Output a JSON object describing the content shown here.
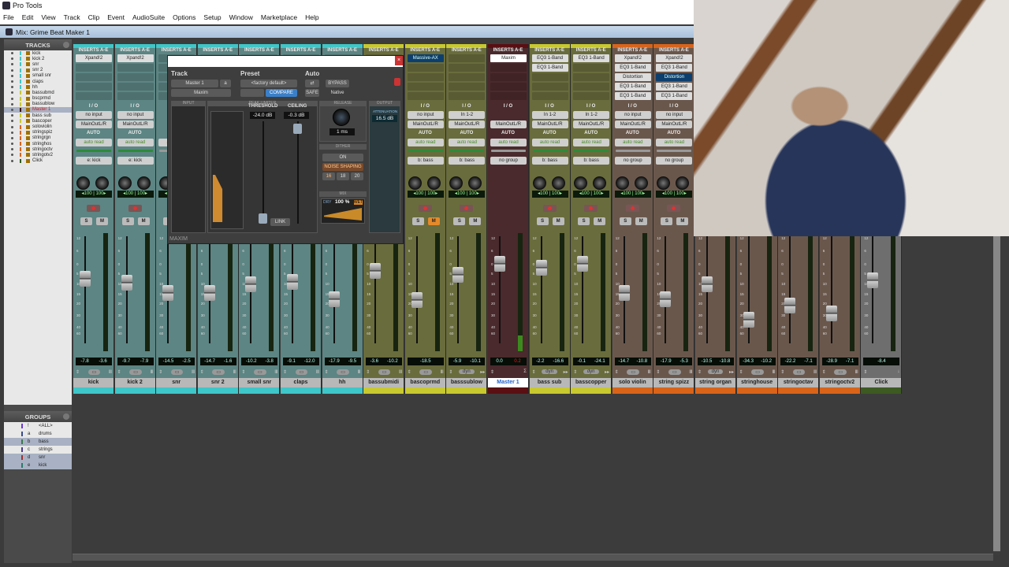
{
  "app": {
    "title": "Pro Tools",
    "window_title": "Mix: Grime Beat Maker 1"
  },
  "menu": [
    "File",
    "Edit",
    "View",
    "Track",
    "Clip",
    "Event",
    "AudioSuite",
    "Options",
    "Setup",
    "Window",
    "Marketplace",
    "Help"
  ],
  "tracks_panel": {
    "title": "TRACKS",
    "items": [
      {
        "name": "kick",
        "color": "#3fc6c8"
      },
      {
        "name": "kick 2",
        "color": "#3fc6c8"
      },
      {
        "name": "snr",
        "color": "#3fc6c8"
      },
      {
        "name": "snr 2",
        "color": "#3fc6c8"
      },
      {
        "name": "small snr",
        "color": "#3fc6c8"
      },
      {
        "name": "claps",
        "color": "#3fc6c8"
      },
      {
        "name": "hh",
        "color": "#3fc6c8"
      },
      {
        "name": "bassubmd",
        "color": "#c8c830"
      },
      {
        "name": "bscprmd",
        "color": "#c8c830"
      },
      {
        "name": "bassublow",
        "color": "#c8c830"
      },
      {
        "name": "Master 1",
        "color": "#3a1010",
        "selected": true
      },
      {
        "name": "bass sub",
        "color": "#c8c830"
      },
      {
        "name": "bascoper",
        "color": "#c8c830"
      },
      {
        "name": "soloviolin",
        "color": "#d8641a"
      },
      {
        "name": "stringspiz",
        "color": "#d8641a"
      },
      {
        "name": "stringrgn",
        "color": "#d8641a"
      },
      {
        "name": "stringhos",
        "color": "#d8641a"
      },
      {
        "name": "stringoctv",
        "color": "#d8641a"
      },
      {
        "name": "stringotv2",
        "color": "#d8641a"
      },
      {
        "name": "Click",
        "color": "#2e5a1e"
      }
    ]
  },
  "groups_panel": {
    "title": "GROUPS",
    "items": [
      {
        "id": "!",
        "name": "<ALL>",
        "color": "#6a3ad0"
      },
      {
        "id": "a",
        "name": "drums",
        "color": "#3a4a8a"
      },
      {
        "id": "b",
        "name": "bass",
        "color": "#3a7a4a",
        "selected": true
      },
      {
        "id": "c",
        "name": "strings",
        "color": "#4a3a8a"
      },
      {
        "id": "d",
        "name": "snr",
        "color": "#a03030",
        "selected": true
      },
      {
        "id": "e",
        "name": "kick",
        "color": "#2a7a6a",
        "selected": true
      }
    ]
  },
  "mixer": {
    "inserts_label": "INSERTS A-E",
    "io_label": "I / O",
    "auto_label": "AUTO",
    "auto_mode": "auto read",
    "solo_label": "S",
    "mute_label": "M",
    "pan_left": "◂100",
    "pan_right": "100▸"
  },
  "palette": {
    "teal": {
      "bar": "#3fc6c8",
      "bg": "#5c8583"
    },
    "yellow": {
      "bar": "#c8c830",
      "bg": "#696c3c"
    },
    "master": {
      "bar": "#5a0f12",
      "bg": "#4a2a2c"
    },
    "orange": {
      "bar": "#d8641a",
      "bg": "#6a574c"
    },
    "click": {
      "bar": "#3d5a22",
      "bg": "#6e6e6e"
    }
  },
  "channels": [
    {
      "name": "kick",
      "pal": "teal",
      "inserts": [
        "Xpand!2"
      ],
      "input": "no input",
      "output": "MainOutL/R",
      "group": "e: kick",
      "vol": "-7.8",
      "peak": "-3.6",
      "icon": "inst",
      "rec": true
    },
    {
      "name": "kick 2",
      "pal": "teal",
      "inserts": [
        "Xpand!2"
      ],
      "input": "no input",
      "output": "MainOutL/R",
      "group": "e: kick",
      "vol": "-9.7",
      "peak": "-7.9",
      "icon": "inst",
      "rec": true
    },
    {
      "name": "snr",
      "pal": "teal",
      "inserts": [],
      "input": "",
      "output": "",
      "group": "",
      "vol": "-14.5",
      "peak": "-2.5",
      "icon": "inst",
      "rec": true
    },
    {
      "name": "snr 2",
      "pal": "teal",
      "inserts": [],
      "input": "",
      "output": "",
      "group": "",
      "vol": "-14.7",
      "peak": "-1.6",
      "icon": "inst",
      "rec": true
    },
    {
      "name": "small snr",
      "pal": "teal",
      "inserts": [],
      "input": "",
      "output": "",
      "group": "",
      "vol": "-10.2",
      "peak": "-3.8",
      "icon": "inst",
      "rec": true
    },
    {
      "name": "claps",
      "pal": "teal",
      "inserts": [],
      "input": "",
      "output": "",
      "group": "",
      "vol": "-9.1",
      "peak": "-12.0",
      "icon": "inst",
      "rec": true
    },
    {
      "name": "hh",
      "pal": "teal",
      "inserts": [],
      "input": "",
      "output": "",
      "group": "",
      "vol": "-17.9",
      "peak": "-9.5",
      "icon": "inst",
      "rec": true
    },
    {
      "name": "bassubmidi",
      "pal": "yellow",
      "inserts": [],
      "input": "",
      "output": "",
      "group": "",
      "vol": "-3.6",
      "peak": "-10.2",
      "icon": "inst",
      "rec": true
    },
    {
      "name": "bascoprmd",
      "pal": "yellow",
      "inserts": [
        "Massive-AX*"
      ],
      "input": "no input",
      "output": "MainOutL/R",
      "group": "b: bass",
      "vol": "-18.5",
      "peak": "",
      "icon": "inst",
      "rec": true,
      "mute": true
    },
    {
      "name": "basssublow",
      "pal": "yellow",
      "inserts": [],
      "input": "In 1-2",
      "output": "MainOutL/R",
      "group": "b: bass",
      "vol": "-5.9",
      "peak": "-10.1",
      "icon": "dyn",
      "rec": true
    },
    {
      "name": "Master 1",
      "pal": "master",
      "inserts": [
        "Maxim"
      ],
      "input": "",
      "output": "MainOutL/R",
      "group": "no group",
      "vol": "0.0",
      "peak": "0.2",
      "icon": "sum",
      "selected": true,
      "clip": true
    },
    {
      "name": "bass sub",
      "pal": "yellow",
      "inserts": [
        "EQ3 1-Band",
        "EQ3 1-Band"
      ],
      "input": "In 1-2",
      "output": "MainOutL/R",
      "group": "b: bass",
      "vol": "-2.2",
      "peak": "-16.6",
      "icon": "dyn",
      "rec": true
    },
    {
      "name": "basscopper",
      "pal": "yellow",
      "inserts": [
        "EQ3 1-Band"
      ],
      "input": "In 1-2",
      "output": "MainOutL/R",
      "group": "b: bass",
      "vol": "-0.1",
      "peak": "-24.1",
      "icon": "dyn",
      "rec": true
    },
    {
      "name": "solo violin",
      "pal": "orange",
      "inserts": [
        "Xpand!2",
        "EQ3 1-Band",
        "Distortion",
        "EQ3 1-Band",
        "EQ3 1-Band"
      ],
      "input": "no input",
      "output": "MainOutL/R",
      "group": "no group",
      "vol": "-14.7",
      "peak": "-10.8",
      "icon": "inst",
      "rec": true
    },
    {
      "name": "string spizz",
      "pal": "orange",
      "inserts": [
        "Xpand!2",
        "EQ3 1-Band",
        "Distortion*",
        "EQ3 1-Band",
        "EQ3 1-Band"
      ],
      "input": "no input",
      "output": "MainOutL/R",
      "group": "no group",
      "vol": "-17.9",
      "peak": "-5.3",
      "icon": "inst",
      "rec": true
    },
    {
      "name": "string organ",
      "pal": "orange",
      "inserts": [],
      "input": "",
      "output": "",
      "group": "",
      "vol": "-10.5",
      "peak": "-10.8",
      "icon": "dyn"
    },
    {
      "name": "stringhouse",
      "pal": "orange",
      "inserts": [],
      "input": "",
      "output": "",
      "group": "",
      "vol": "-34.3",
      "peak": "-10.2",
      "icon": "inst"
    },
    {
      "name": "stringoctav",
      "pal": "orange",
      "inserts": [],
      "input": "",
      "output": "",
      "group": "",
      "vol": "-22.2",
      "peak": "-7.1",
      "icon": "inst"
    },
    {
      "name": "stringoctv2",
      "pal": "orange",
      "inserts": [],
      "input": "",
      "output": "",
      "group": "",
      "vol": "-28.9",
      "peak": "-7.1",
      "icon": "inst"
    },
    {
      "name": "Click",
      "pal": "click",
      "inserts": [],
      "input": "",
      "output": "",
      "group": "",
      "vol": "-8.4",
      "peak": "",
      "icon": "click"
    }
  ],
  "plugin": {
    "track_label": "Track",
    "preset_label": "Preset",
    "auto_label": "Auto",
    "track": "Master 1",
    "slot": "a",
    "plugin_name": "Maxim",
    "preset": "<factory default>",
    "compare": "COMPARE",
    "safe": "SAFE",
    "bypass": "BYPASS",
    "native": "Native",
    "input_label": "INPUT",
    "peak_limiter_label": "PEAK LIMITER",
    "release_label": "RELEASE",
    "output_label": "OUTPUT",
    "threshold_label": "THRESHOLD",
    "ceiling_label": "CEILING",
    "threshold": "-24.0 dB",
    "ceiling": "-0.3 dB",
    "release": "1 ms",
    "attenuation_label": "ATTENUATION",
    "attenuation": "16.5 dB",
    "dither_label": "DITHER",
    "dither_on": "ON",
    "noise_shaping": "NOISE SHAPING",
    "bits": [
      "16",
      "18",
      "20"
    ],
    "mix_label": "MIX",
    "dry": "DRY",
    "mix": "100 %",
    "wet": "WET",
    "link": "LINK",
    "footer": "MAXIM"
  }
}
